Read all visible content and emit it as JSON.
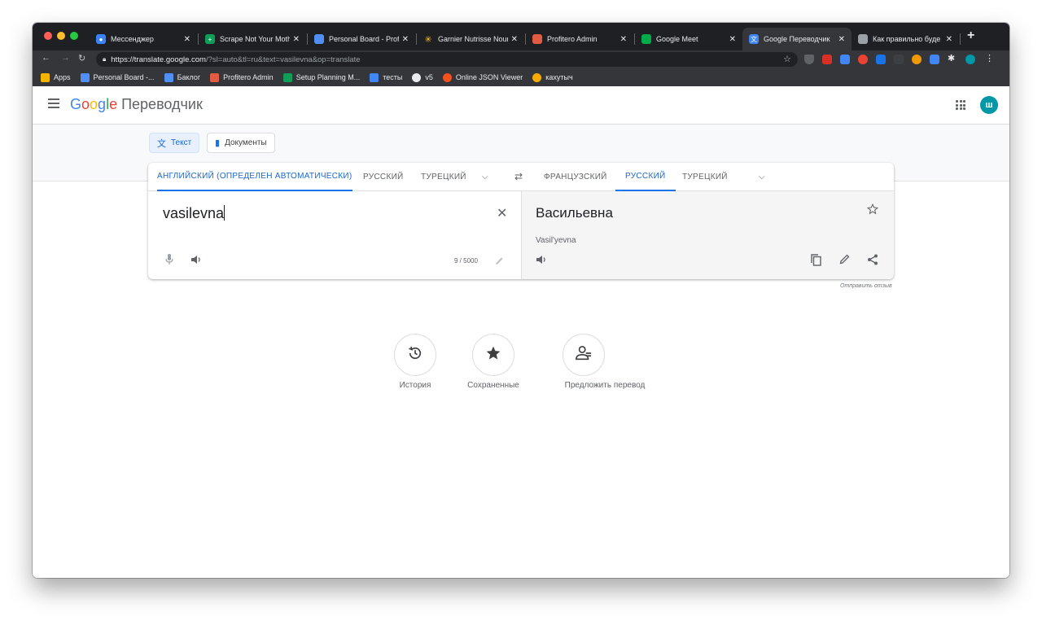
{
  "browser": {
    "tabs": [
      {
        "title": "Мессенджер",
        "icon": "messenger-icon",
        "color": "#3b82f6"
      },
      {
        "title": "Scrape Not Your Moth",
        "icon": "sheets-icon",
        "color": "#0f9d58"
      },
      {
        "title": "Personal Board - Profi",
        "icon": "board-icon",
        "color": "#4f8ff7"
      },
      {
        "title": "Garnier Nutrisse Nour",
        "icon": "walmart-icon",
        "color": "#ffc220"
      },
      {
        "title": "Profitero Admin",
        "icon": "profitero-icon",
        "color": "#e25b45"
      },
      {
        "title": "Google Meet",
        "icon": "meet-icon",
        "color": "#00ac47"
      },
      {
        "title": "Google Переводчик",
        "icon": "translate-icon",
        "color": "#4285f4"
      },
      {
        "title": "Как правильно буде",
        "icon": "grid-site-icon",
        "color": "#9aa0a6"
      }
    ],
    "url": {
      "host": "https://translate.google.com",
      "path": "/?sl=auto&tl=ru&text=vasilevna&op=translate"
    },
    "bookmarks": [
      {
        "label": "Apps",
        "color": "#f4b400"
      },
      {
        "label": "Personal Board -...",
        "color": "#4f8ff7"
      },
      {
        "label": "Баклог",
        "color": "#4f8ff7"
      },
      {
        "label": "Profitero Admin",
        "color": "#e25b45"
      },
      {
        "label": "Setup Planning M...",
        "color": "#0f9d58"
      },
      {
        "label": "тесты",
        "color": "#4285f4"
      },
      {
        "label": "v5",
        "color": "#e8eaed"
      },
      {
        "label": "Online JSON Viewer",
        "color": "#f4511e"
      },
      {
        "label": "кахутыч",
        "color": "#f9ab00"
      }
    ]
  },
  "header": {
    "logo": "Google",
    "product": "Переводчик",
    "avatar": "ш"
  },
  "modes": {
    "text": "Текст",
    "documents": "Документы"
  },
  "source_langs": {
    "detected": "АНГЛИЙСКИЙ (ОПРЕДЕЛЕН АВТОМАТИЧЕСКИ)",
    "lang2": "РУССКИЙ",
    "lang3": "ТУРЕЦКИЙ"
  },
  "target_langs": {
    "lang1": "ФРАНЦУЗСКИЙ",
    "lang2": "РУССКИЙ",
    "lang3": "ТУРЕЦКИЙ"
  },
  "source": {
    "text": "vasilevna",
    "counter": "9 / 5000"
  },
  "target": {
    "text": "Васильевна",
    "transliteration": "Vasil'yevna"
  },
  "feedback": "Отправить отзыв",
  "actions": {
    "history": "История",
    "saved": "Сохраненные",
    "suggest": "Предложить перевод"
  },
  "colors": {
    "accent": "#1a73e8",
    "active_text": "#1967d2",
    "avatar": "#0097a7"
  }
}
